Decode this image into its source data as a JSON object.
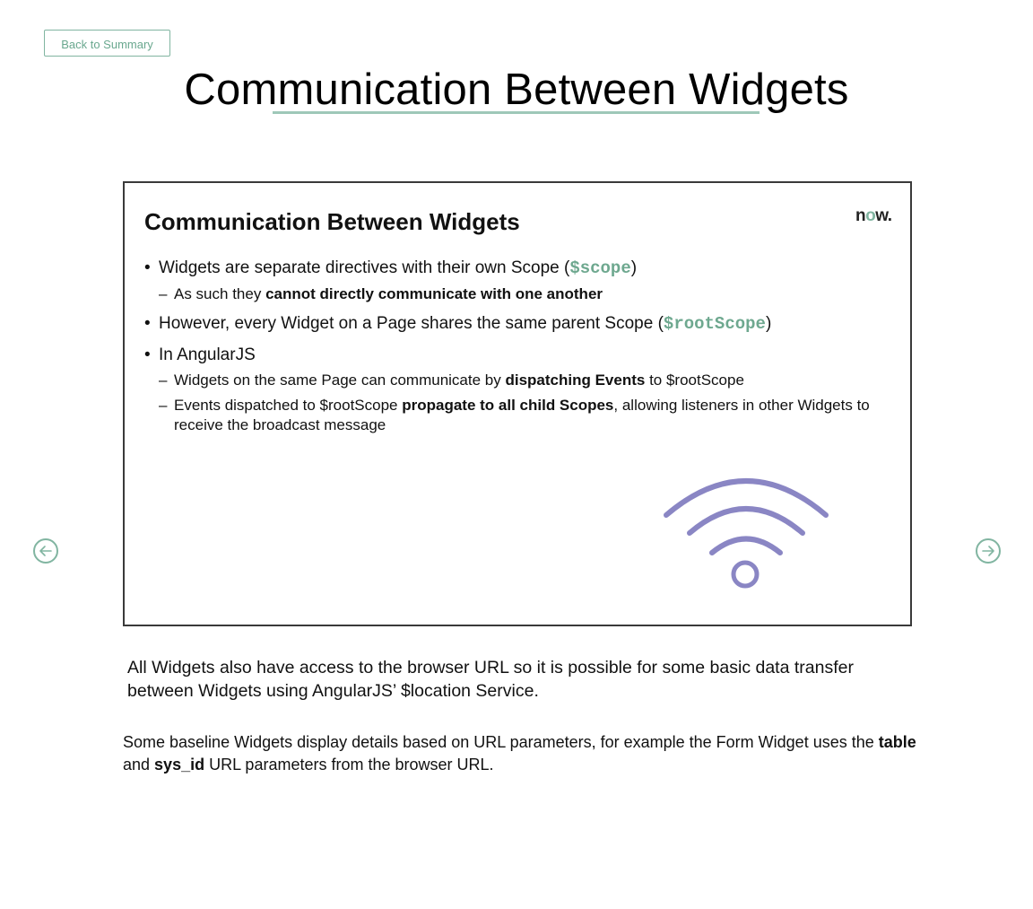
{
  "header": {
    "back_label": "Back to Summary",
    "page_title": "Communication Between Widgets"
  },
  "slide": {
    "title": "Communication Between Widgets",
    "logo_text_n": "n",
    "logo_text_o": "o",
    "logo_text_w": "w.",
    "b1_text": "Widgets are separate directives with their own Scope (",
    "b1_code": "$scope",
    "b1_close": ")",
    "b1_sub_text": "As such they ",
    "b1_sub_bold": "cannot directly communicate with one another",
    "b2_text": "However, every Widget on a Page shares the same parent Scope (",
    "b2_code": "$rootScope",
    "b2_close": ")",
    "b3_text": "In AngularJS",
    "b3_sub1_text": "Widgets on the same Page can communicate by ",
    "b3_sub1_bold": "dispatching Events",
    "b3_sub1_end": " to $rootScope",
    "b3_sub2_text": "Events dispatched to $rootScope ",
    "b3_sub2_bold": "propagate to all child Scopes",
    "b3_sub2_end": ", allowing listeners in other Widgets to receive the broadcast message",
    "bullet_char": "•",
    "dash_char": "–",
    "icon": "wifi-broadcast-icon",
    "icon_color": "#8a86c4"
  },
  "body": {
    "para1": "All Widgets also have access to the browser URL so it is possible for some basic data transfer between Widgets using AngularJS’ $location Service.",
    "para2_a": "Some baseline Widgets display details based on URL parameters, for example the Form Widget uses the ",
    "para2_b1": "table",
    "para2_mid": " and ",
    "para2_b2": "sys_id",
    "para2_end": " URL parameters from the browser URL."
  },
  "nav": {
    "prev_icon": "arrow-left-circle-icon",
    "next_icon": "arrow-right-circle-icon"
  },
  "colors": {
    "accent": "#81b5a1",
    "code": "#6ea88f"
  }
}
